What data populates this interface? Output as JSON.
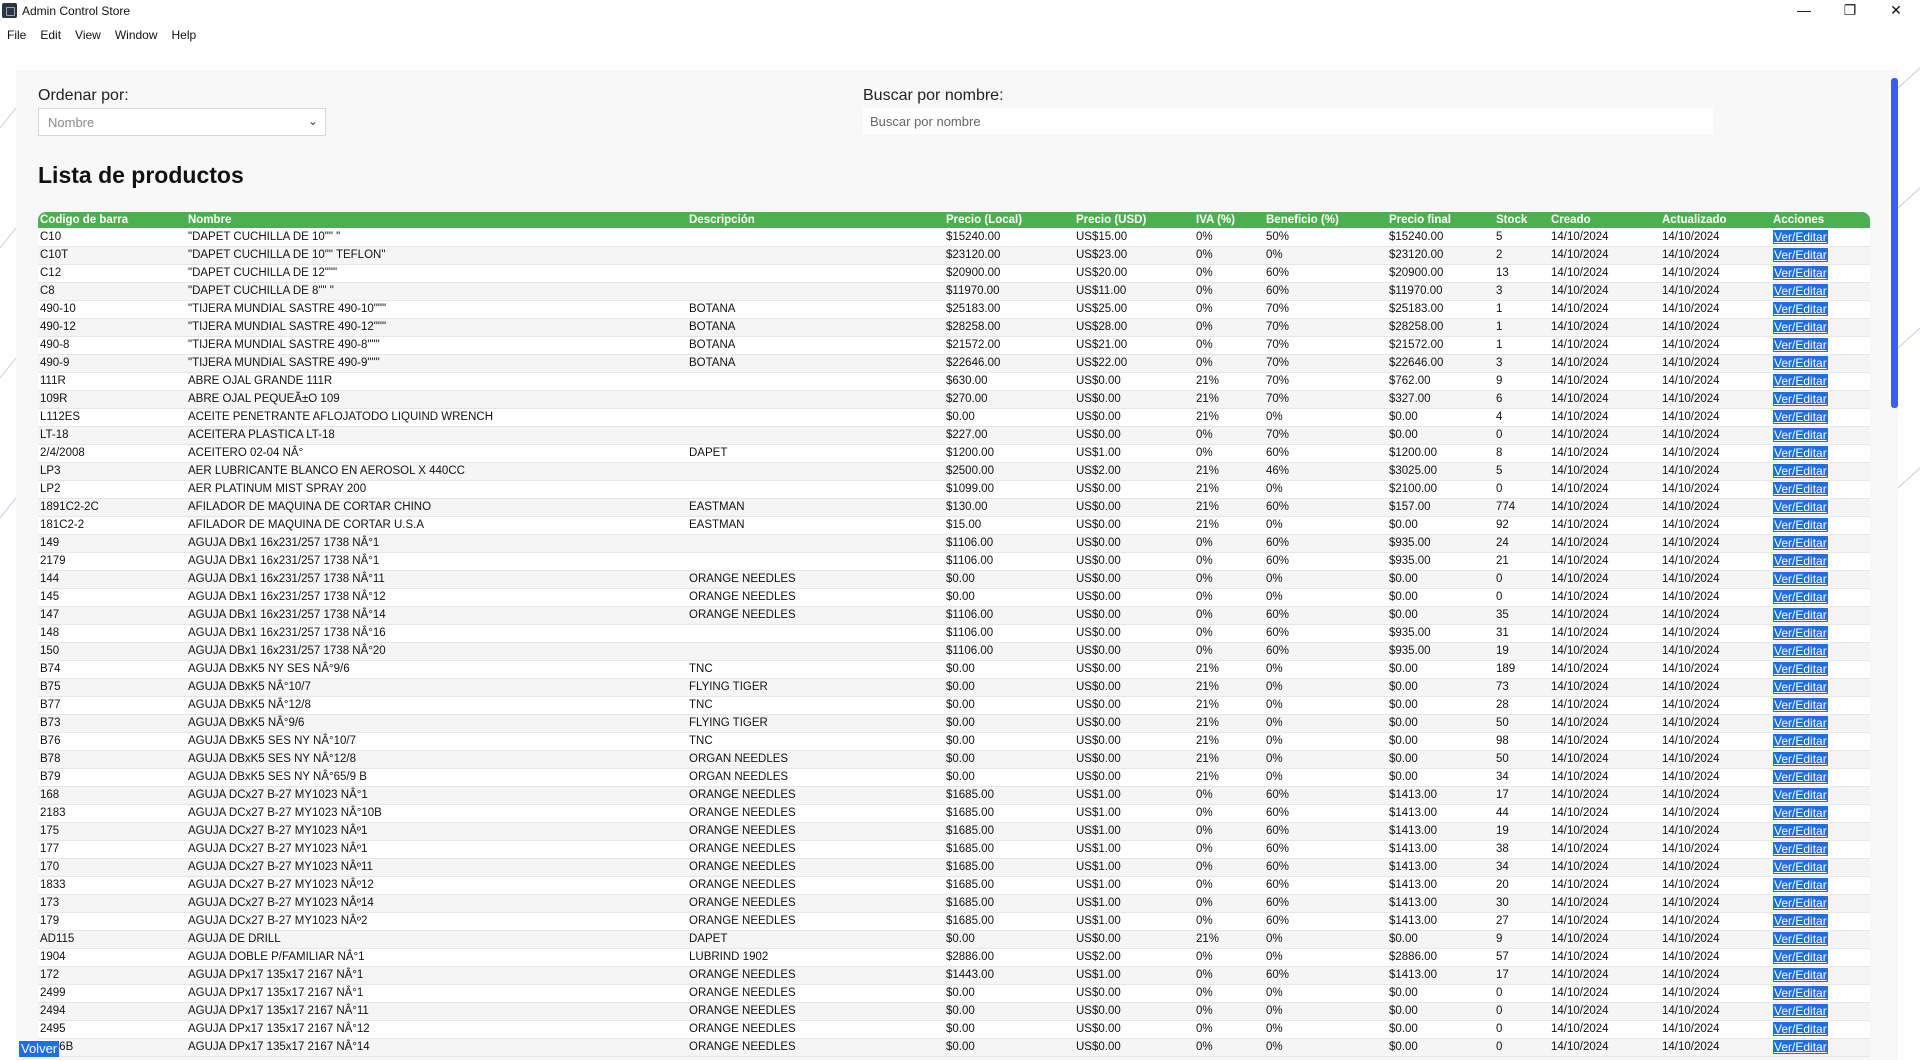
{
  "window": {
    "title": "Admin Control Store",
    "minimize": "—",
    "maximize": "❐",
    "close": "✕"
  },
  "menu": [
    "File",
    "Edit",
    "View",
    "Window",
    "Help"
  ],
  "sort": {
    "label": "Ordenar por:",
    "value": "Nombre"
  },
  "search": {
    "label": "Buscar por nombre:",
    "placeholder": "Buscar por nombre"
  },
  "page_title": "Lista de productos",
  "columns": [
    "Codigo de barra",
    "Nombre",
    "Descripción",
    "Precio (Local)",
    "Precio (USD)",
    "IVA (%)",
    "Beneficio (%)",
    "Precio final",
    "Stock",
    "Creado",
    "Actualizado",
    "Acciones"
  ],
  "edit_label": "Ver/Editar",
  "back_label": "Volver",
  "rows": [
    [
      "C10",
      "\"DAPET CUCHILLA DE 10\"\" \"",
      "",
      "$15240.00",
      "US$15.00",
      "0%",
      "50%",
      "$15240.00",
      "5",
      "14/10/2024",
      "14/10/2024"
    ],
    [
      "C10T",
      "\"DAPET CUCHILLA DE 10\"\" TEFLON\"",
      "",
      "$23120.00",
      "US$23.00",
      "0%",
      "0%",
      "$23120.00",
      "2",
      "14/10/2024",
      "14/10/2024"
    ],
    [
      "C12",
      "\"DAPET CUCHILLA DE 12\"\"\"",
      "",
      "$20900.00",
      "US$20.00",
      "0%",
      "60%",
      "$20900.00",
      "13",
      "14/10/2024",
      "14/10/2024"
    ],
    [
      "C8",
      "\"DAPET CUCHILLA DE 8\"\" \"",
      "",
      "$11970.00",
      "US$11.00",
      "0%",
      "60%",
      "$11970.00",
      "3",
      "14/10/2024",
      "14/10/2024"
    ],
    [
      "490-10",
      "\"TIJERA MUNDIAL SASTRE 490-10\"\"\"",
      "BOTANA",
      "$25183.00",
      "US$25.00",
      "0%",
      "70%",
      "$25183.00",
      "1",
      "14/10/2024",
      "14/10/2024"
    ],
    [
      "490-12",
      "\"TIJERA MUNDIAL SASTRE 490-12\"\"\"",
      "BOTANA",
      "$28258.00",
      "US$28.00",
      "0%",
      "70%",
      "$28258.00",
      "1",
      "14/10/2024",
      "14/10/2024"
    ],
    [
      "490-8",
      "\"TIJERA MUNDIAL SASTRE 490-8\"\"\"",
      "BOTANA",
      "$21572.00",
      "US$21.00",
      "0%",
      "70%",
      "$21572.00",
      "1",
      "14/10/2024",
      "14/10/2024"
    ],
    [
      "490-9",
      "\"TIJERA MUNDIAL SASTRE 490-9\"\"\"",
      "BOTANA",
      "$22646.00",
      "US$22.00",
      "0%",
      "70%",
      "$22646.00",
      "3",
      "14/10/2024",
      "14/10/2024"
    ],
    [
      "111R",
      "ABRE OJAL GRANDE 111R",
      "",
      "$630.00",
      "US$0.00",
      "21%",
      "70%",
      "$762.00",
      "9",
      "14/10/2024",
      "14/10/2024"
    ],
    [
      "109R",
      "ABRE OJAL PEQUEÃ±O 109",
      "",
      "$270.00",
      "US$0.00",
      "21%",
      "70%",
      "$327.00",
      "6",
      "14/10/2024",
      "14/10/2024"
    ],
    [
      "L112ES",
      "ACEITE PENETRANTE AFLOJATODO LIQUIND WRENCH",
      "",
      "$0.00",
      "US$0.00",
      "21%",
      "0%",
      "$0.00",
      "4",
      "14/10/2024",
      "14/10/2024"
    ],
    [
      "LT-18",
      "ACEITERA PLASTICA LT-18",
      "",
      "$227.00",
      "US$0.00",
      "0%",
      "70%",
      "$0.00",
      "0",
      "14/10/2024",
      "14/10/2024"
    ],
    [
      "2/4/2008",
      "ACEITERO 02-04 NÂ°",
      "DAPET",
      "$1200.00",
      "US$1.00",
      "0%",
      "60%",
      "$1200.00",
      "8",
      "14/10/2024",
      "14/10/2024"
    ],
    [
      "LP3",
      "AER LUBRICANTE BLANCO EN AEROSOL X 440CC",
      "",
      "$2500.00",
      "US$2.00",
      "21%",
      "46%",
      "$3025.00",
      "5",
      "14/10/2024",
      "14/10/2024"
    ],
    [
      "LP2",
      "AER PLATINUM MIST SPRAY 200",
      "",
      "$1099.00",
      "US$0.00",
      "21%",
      "0%",
      "$2100.00",
      "0",
      "14/10/2024",
      "14/10/2024"
    ],
    [
      "1891C2-2C",
      "AFILADOR DE MAQUINA DE CORTAR CHINO",
      "EASTMAN",
      "$130.00",
      "US$0.00",
      "21%",
      "60%",
      "$157.00",
      "774",
      "14/10/2024",
      "14/10/2024"
    ],
    [
      "181C2-2",
      "AFILADOR DE MAQUINA DE CORTAR U.S.A",
      "EASTMAN",
      "$15.00",
      "US$0.00",
      "21%",
      "0%",
      "$0.00",
      "92",
      "14/10/2024",
      "14/10/2024"
    ],
    [
      "149",
      "AGUJA DBx1 16x231/257 1738 NÂ°1",
      "",
      "$1106.00",
      "US$0.00",
      "0%",
      "60%",
      "$935.00",
      "24",
      "14/10/2024",
      "14/10/2024"
    ],
    [
      "2179",
      "AGUJA DBx1 16x231/257 1738 NÂ°1",
      "",
      "$1106.00",
      "US$0.00",
      "0%",
      "60%",
      "$935.00",
      "21",
      "14/10/2024",
      "14/10/2024"
    ],
    [
      "144",
      "AGUJA DBx1 16x231/257 1738 NÂ°11",
      "ORANGE NEEDLES",
      "$0.00",
      "US$0.00",
      "0%",
      "0%",
      "$0.00",
      "0",
      "14/10/2024",
      "14/10/2024"
    ],
    [
      "145",
      "AGUJA DBx1 16x231/257 1738 NÂ°12",
      "ORANGE NEEDLES",
      "$0.00",
      "US$0.00",
      "0%",
      "0%",
      "$0.00",
      "0",
      "14/10/2024",
      "14/10/2024"
    ],
    [
      "147",
      "AGUJA DBx1 16x231/257 1738 NÂ°14",
      "ORANGE NEEDLES",
      "$1106.00",
      "US$0.00",
      "0%",
      "60%",
      "$0.00",
      "35",
      "14/10/2024",
      "14/10/2024"
    ],
    [
      "148",
      "AGUJA DBx1 16x231/257 1738 NÂ°16",
      "",
      "$1106.00",
      "US$0.00",
      "0%",
      "60%",
      "$935.00",
      "31",
      "14/10/2024",
      "14/10/2024"
    ],
    [
      "150",
      "AGUJA DBx1 16x231/257 1738 NÂ°20",
      "",
      "$1106.00",
      "US$0.00",
      "0%",
      "60%",
      "$935.00",
      "19",
      "14/10/2024",
      "14/10/2024"
    ],
    [
      "B74",
      "AGUJA DBxK5 NY SES NÂ°9/6",
      "TNC",
      "$0.00",
      "US$0.00",
      "21%",
      "0%",
      "$0.00",
      "189",
      "14/10/2024",
      "14/10/2024"
    ],
    [
      "B75",
      "AGUJA DBxK5 NÂ°10/7",
      "FLYING TIGER",
      "$0.00",
      "US$0.00",
      "21%",
      "0%",
      "$0.00",
      "73",
      "14/10/2024",
      "14/10/2024"
    ],
    [
      "B77",
      "AGUJA DBxK5 NÂ°12/8",
      "TNC",
      "$0.00",
      "US$0.00",
      "21%",
      "0%",
      "$0.00",
      "28",
      "14/10/2024",
      "14/10/2024"
    ],
    [
      "B73",
      "AGUJA DBxK5 NÂ°9/6",
      "FLYING TIGER",
      "$0.00",
      "US$0.00",
      "21%",
      "0%",
      "$0.00",
      "50",
      "14/10/2024",
      "14/10/2024"
    ],
    [
      "B76",
      "AGUJA DBxK5 SES NY NÂ°10/7",
      "TNC",
      "$0.00",
      "US$0.00",
      "21%",
      "0%",
      "$0.00",
      "98",
      "14/10/2024",
      "14/10/2024"
    ],
    [
      "B78",
      "AGUJA DBxK5 SES NY NÂ°12/8",
      "ORGAN NEEDLES",
      "$0.00",
      "US$0.00",
      "21%",
      "0%",
      "$0.00",
      "50",
      "14/10/2024",
      "14/10/2024"
    ],
    [
      "B79",
      "AGUJA DBxK5 SES NY NÂ°65/9 B",
      "ORGAN NEEDLES",
      "$0.00",
      "US$0.00",
      "21%",
      "0%",
      "$0.00",
      "34",
      "14/10/2024",
      "14/10/2024"
    ],
    [
      "168",
      "AGUJA DCx27 B-27 MY1023 NÂ°1",
      "ORANGE NEEDLES",
      "$1685.00",
      "US$1.00",
      "0%",
      "60%",
      "$1413.00",
      "17",
      "14/10/2024",
      "14/10/2024"
    ],
    [
      "2183",
      "AGUJA DCx27 B-27 MY1023 NÂ°10B",
      "ORANGE NEEDLES",
      "$1685.00",
      "US$1.00",
      "0%",
      "60%",
      "$1413.00",
      "44",
      "14/10/2024",
      "14/10/2024"
    ],
    [
      "175",
      "AGUJA DCx27 B-27 MY1023 NÂº1",
      "ORANGE NEEDLES",
      "$1685.00",
      "US$1.00",
      "0%",
      "60%",
      "$1413.00",
      "19",
      "14/10/2024",
      "14/10/2024"
    ],
    [
      "177",
      "AGUJA DCx27 B-27 MY1023 NÂº1",
      "ORANGE NEEDLES",
      "$1685.00",
      "US$1.00",
      "0%",
      "60%",
      "$1413.00",
      "38",
      "14/10/2024",
      "14/10/2024"
    ],
    [
      "170",
      "AGUJA DCx27 B-27 MY1023 NÂº11",
      "ORANGE NEEDLES",
      "$1685.00",
      "US$1.00",
      "0%",
      "60%",
      "$1413.00",
      "34",
      "14/10/2024",
      "14/10/2024"
    ],
    [
      "1833",
      "AGUJA DCx27 B-27 MY1023 NÂº12",
      "ORANGE NEEDLES",
      "$1685.00",
      "US$1.00",
      "0%",
      "60%",
      "$1413.00",
      "20",
      "14/10/2024",
      "14/10/2024"
    ],
    [
      "173",
      "AGUJA DCx27 B-27 MY1023 NÂº14",
      "ORANGE NEEDLES",
      "$1685.00",
      "US$1.00",
      "0%",
      "60%",
      "$1413.00",
      "30",
      "14/10/2024",
      "14/10/2024"
    ],
    [
      "179",
      "AGUJA DCx27 B-27 MY1023 NÂº2",
      "ORANGE NEEDLES",
      "$1685.00",
      "US$1.00",
      "0%",
      "60%",
      "$1413.00",
      "27",
      "14/10/2024",
      "14/10/2024"
    ],
    [
      "AD115",
      "AGUJA DE DRILL",
      "DAPET",
      "$0.00",
      "US$0.00",
      "21%",
      "0%",
      "$0.00",
      "9",
      "14/10/2024",
      "14/10/2024"
    ],
    [
      "1904",
      "AGUJA DOBLE P/FAMILIAR NÂ°1",
      "LUBRIND 1902",
      "$2886.00",
      "US$2.00",
      "0%",
      "0%",
      "$2886.00",
      "57",
      "14/10/2024",
      "14/10/2024"
    ],
    [
      "172",
      "AGUJA DPx17 135x17 2167 NÂ°1",
      "ORANGE NEEDLES",
      "$1443.00",
      "US$1.00",
      "0%",
      "60%",
      "$1413.00",
      "17",
      "14/10/2024",
      "14/10/2024"
    ],
    [
      "2499",
      "AGUJA DPx17 135x17 2167 NÂ°1",
      "ORANGE NEEDLES",
      "$0.00",
      "US$0.00",
      "0%",
      "0%",
      "$0.00",
      "0",
      "14/10/2024",
      "14/10/2024"
    ],
    [
      "2494",
      "AGUJA DPx17 135x17 2167 NÂ°11",
      "ORANGE NEEDLES",
      "$0.00",
      "US$0.00",
      "0%",
      "0%",
      "$0.00",
      "0",
      "14/10/2024",
      "14/10/2024"
    ],
    [
      "2495",
      "AGUJA DPx17 135x17 2167 NÂ°12",
      "ORANGE NEEDLES",
      "$0.00",
      "US$0.00",
      "0%",
      "0%",
      "$0.00",
      "0",
      "14/10/2024",
      "14/10/2024"
    ],
    [
      "2496B",
      "AGUJA DPx17 135x17 2167 NÂ°14",
      "ORANGE NEEDLES",
      "$0.00",
      "US$0.00",
      "0%",
      "0%",
      "$0.00",
      "0",
      "14/10/2024",
      "14/10/2024"
    ]
  ],
  "colors": {
    "header": "#4caf50",
    "edit_button": "#1e6fe0",
    "scrollbar": "#3b5bfd"
  }
}
